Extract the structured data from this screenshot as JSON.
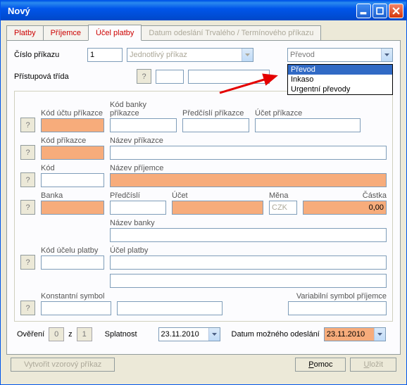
{
  "window": {
    "title": "Nový"
  },
  "tabs": {
    "t1": "Platby",
    "t2": "Příjemce",
    "t3": "Účel platby",
    "t4": "Datum odeslání Trvalého / Termínového příkazu"
  },
  "top": {
    "cislo_label": "Číslo příkazu",
    "cislo_value": "1",
    "typ_label": "Jednotlivý příkaz",
    "prevod_selected": "Převod",
    "dropdown": {
      "o1": "Převod",
      "o2": "Inkaso",
      "o3": "Urgentní převody"
    },
    "pristup_label": "Přístupová třída"
  },
  "labels": {
    "kod_uctu_prikazce": "Kód účtu příkazce",
    "kod_banky_prikazce": "Kód banky příkazce",
    "predcisli_prikazce": "Předčíslí příkazce",
    "ucet_prikazce": "Účet příkazce",
    "kod_prikazce": "Kód příkazce",
    "nazev_prikazce": "Název příkazce",
    "kod": "Kód",
    "nazev_prijemce": "Název příjemce",
    "banka": "Banka",
    "predcisli": "Předčíslí",
    "ucet": "Účet",
    "mena": "Měna",
    "castka": "Částka",
    "nazev_banky": "Název banky",
    "kod_ucelu_platby": "Kód účelu platby",
    "ucel_platby": "Účel platby",
    "konstantni_symbol": "Konstantní symbol",
    "variabilni_symbol_prijemce": "Variabilní symbol příjemce"
  },
  "values": {
    "mena": "CZK",
    "castka": "0,00"
  },
  "footer": {
    "overeni": "Ověření",
    "ov1": "0",
    "z": "z",
    "ov2": "1",
    "splatnost": "Splatnost",
    "splatnost_val": "23.11.2010",
    "datum_label": "Datum možného odeslání",
    "datum_val": "23.11.2010",
    "vytvorit": "Vytvořit vzorový příkaz",
    "pomoc": "Pomoc",
    "ulozit": "Uložit"
  },
  "help": "?"
}
